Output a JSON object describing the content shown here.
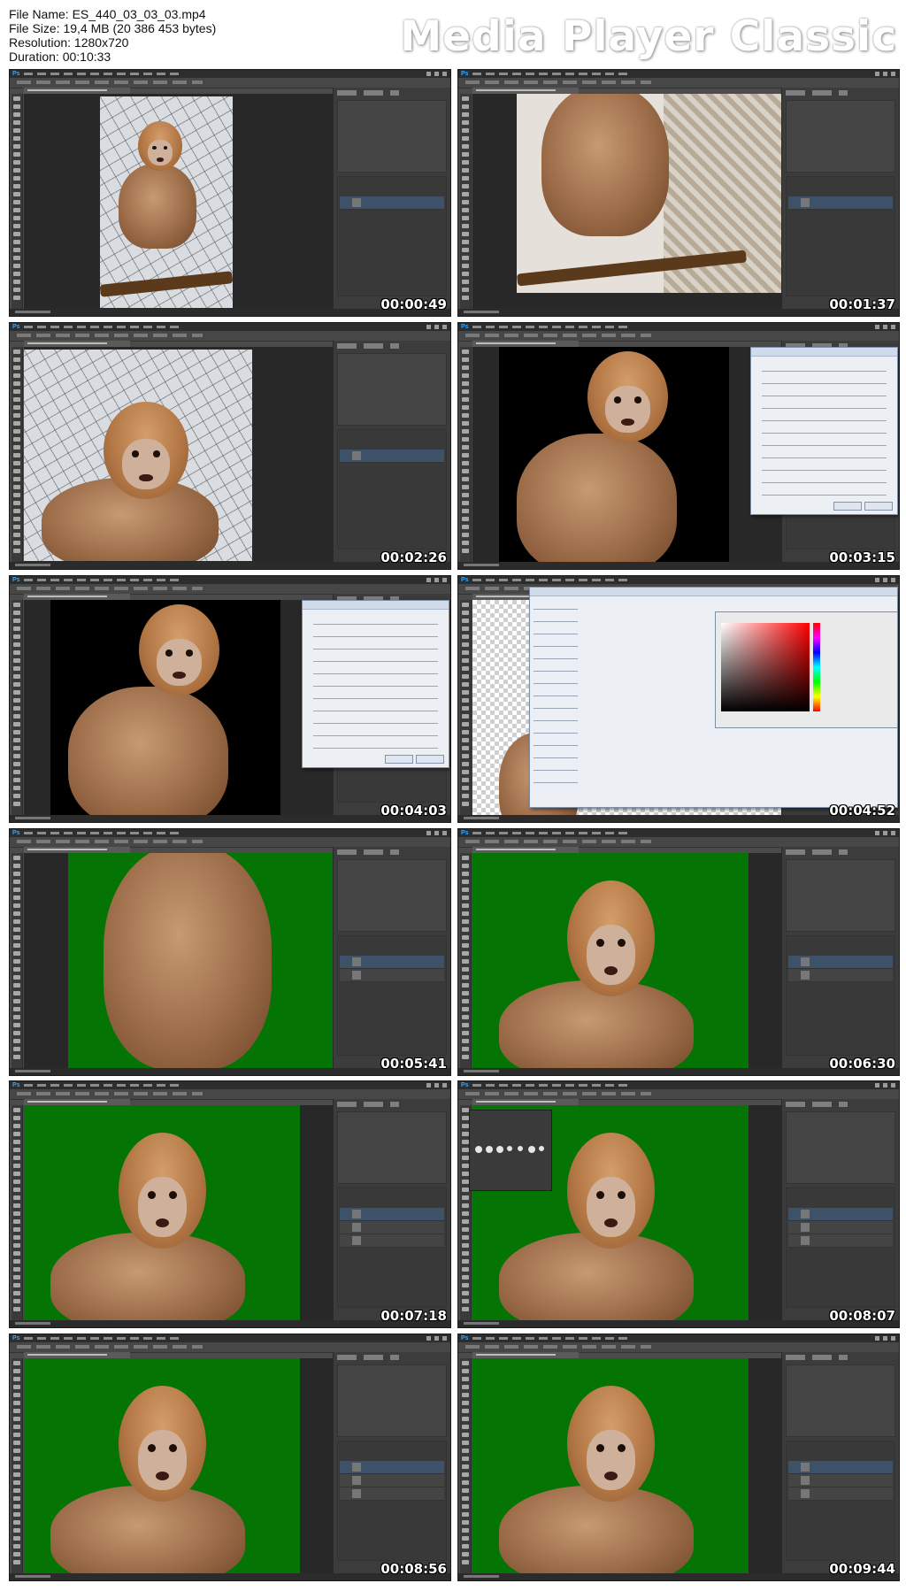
{
  "header": {
    "file_name": "File Name: ES_440_03_03_03.mp4",
    "file_size": "File Size: 19,4 MB (20 386 453 bytes)",
    "resolution": "Resolution: 1280x720",
    "duration": "Duration: 00:10:33",
    "logo": "Media Player Classic"
  },
  "app_icon_text": "Ps",
  "thumbnails": [
    {
      "timestamp": "00:00:49",
      "scene": "pale-portrait",
      "overlay": "none"
    },
    {
      "timestamp": "00:01:37",
      "scene": "rope-closeup",
      "overlay": "none"
    },
    {
      "timestamp": "00:02:26",
      "scene": "pale-face",
      "overlay": "none"
    },
    {
      "timestamp": "00:03:15",
      "scene": "dark",
      "overlay": "refine-dialog"
    },
    {
      "timestamp": "00:04:03",
      "scene": "dark",
      "overlay": "refine-dialog"
    },
    {
      "timestamp": "00:04:52",
      "scene": "checker",
      "overlay": "color-picker"
    },
    {
      "timestamp": "00:05:41",
      "scene": "green-body",
      "overlay": "none"
    },
    {
      "timestamp": "00:06:30",
      "scene": "green-face",
      "overlay": "none"
    },
    {
      "timestamp": "00:07:18",
      "scene": "green-face",
      "overlay": "none"
    },
    {
      "timestamp": "00:08:07",
      "scene": "green-face",
      "overlay": "brush-popup"
    },
    {
      "timestamp": "00:08:56",
      "scene": "green-face",
      "overlay": "none"
    },
    {
      "timestamp": "00:09:44",
      "scene": "green-face",
      "overlay": "none"
    }
  ]
}
